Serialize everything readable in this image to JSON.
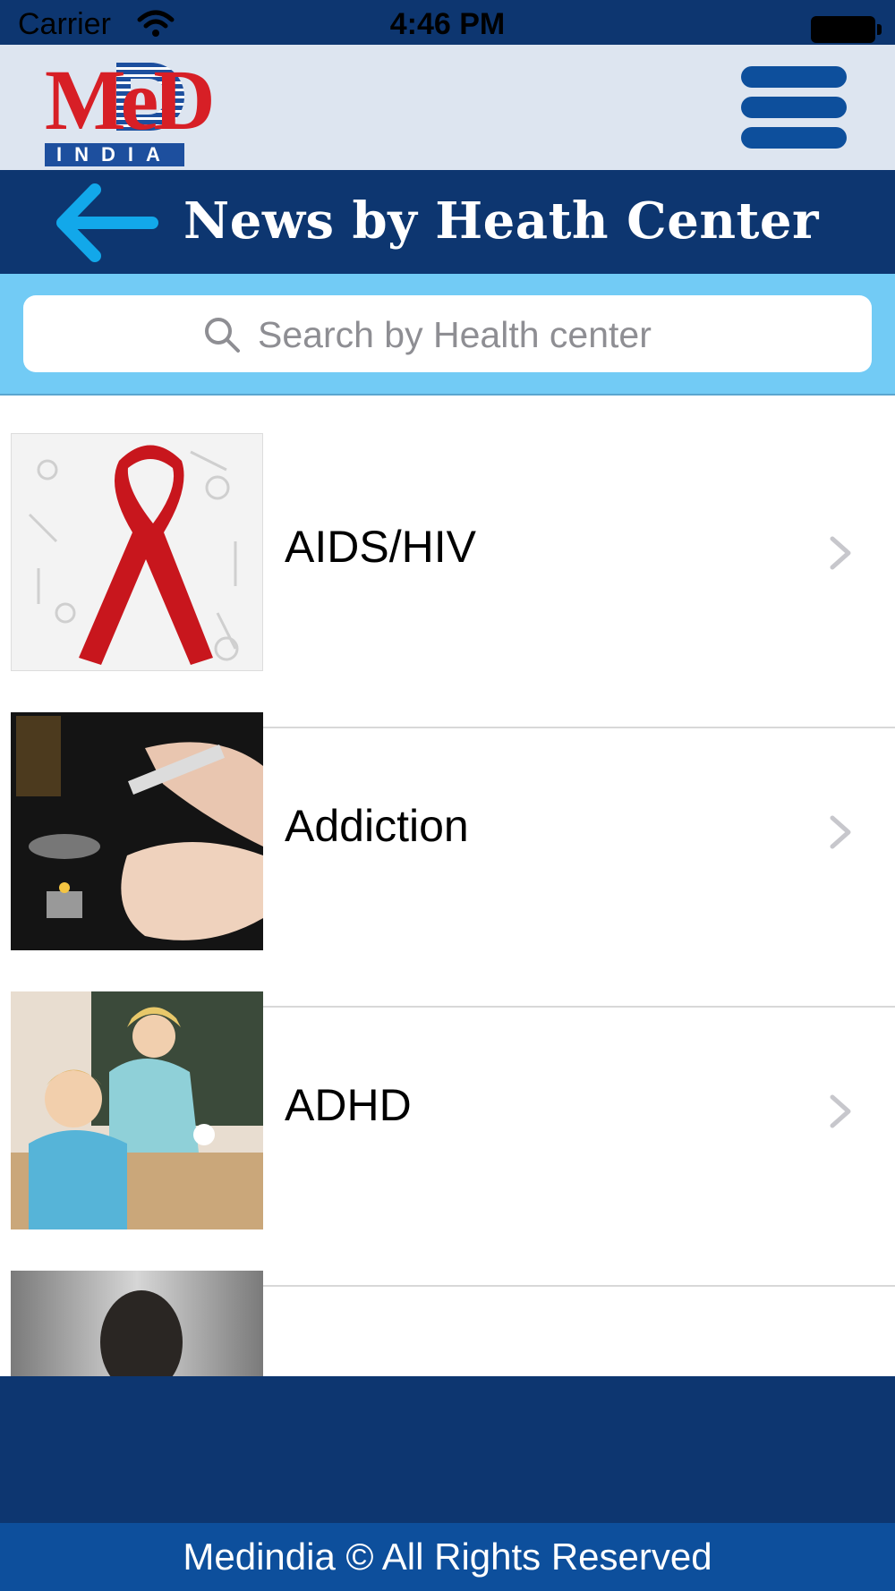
{
  "status_bar": {
    "carrier": "Carrier",
    "time": "4:46 PM"
  },
  "header": {
    "logo": {
      "letters": "MeD",
      "subtitle": "INDIA"
    },
    "menu_icon": "hamburger-menu-icon"
  },
  "title_bar": {
    "back_icon": "arrow-left-icon",
    "title": "News by Heath Center"
  },
  "search": {
    "placeholder": "Search by Health center",
    "value": ""
  },
  "list": {
    "items": [
      {
        "label": "AIDS/HIV",
        "image": "red-ribbon-image"
      },
      {
        "label": "Addiction",
        "image": "syringe-arm-image"
      },
      {
        "label": "ADHD",
        "image": "classroom-boy-teacher-image"
      },
      {
        "label": "",
        "image": "man-head-image"
      }
    ]
  },
  "footer": {
    "text": "Medindia © All Rights Reserved"
  },
  "colors": {
    "navy": "#0d3670",
    "blue": "#0d4f9c",
    "light_blue": "#72cbf5",
    "arrow": "#12a8ea",
    "header_bg": "#dde5f0",
    "logo_red": "#d71f26"
  }
}
